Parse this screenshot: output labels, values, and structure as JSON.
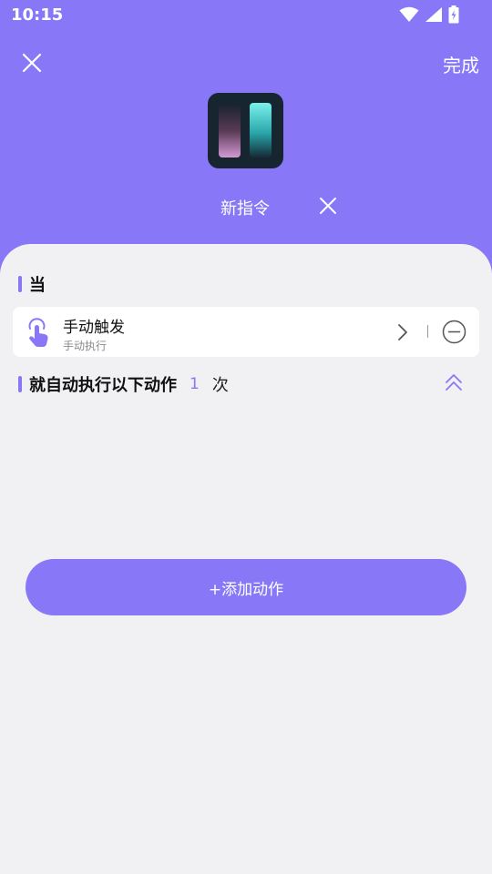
{
  "status_bar": {
    "time": "10:15",
    "icons": [
      "wifi-icon",
      "signal-icon",
      "battery-charging-icon"
    ]
  },
  "header": {
    "done_label": "完成",
    "shortcut_name": "新指令",
    "icons": [
      "close-icon",
      "clear-name-icon"
    ]
  },
  "colors": {
    "accent": "#8878f7",
    "background": "#f1f1f4",
    "card": "#ffffff"
  },
  "when_section": {
    "title": "当",
    "trigger": {
      "name": "手动触发",
      "description": "手动执行",
      "icons": [
        "tap-hand-icon",
        "chevron-right-icon",
        "remove-circle-icon"
      ]
    }
  },
  "actions_section": {
    "title": "就自动执行以下动作",
    "repeat_count": "1",
    "repeat_unit": "次",
    "icons": [
      "double-chevron-up-icon"
    ]
  },
  "add_action_label": "+添加动作"
}
